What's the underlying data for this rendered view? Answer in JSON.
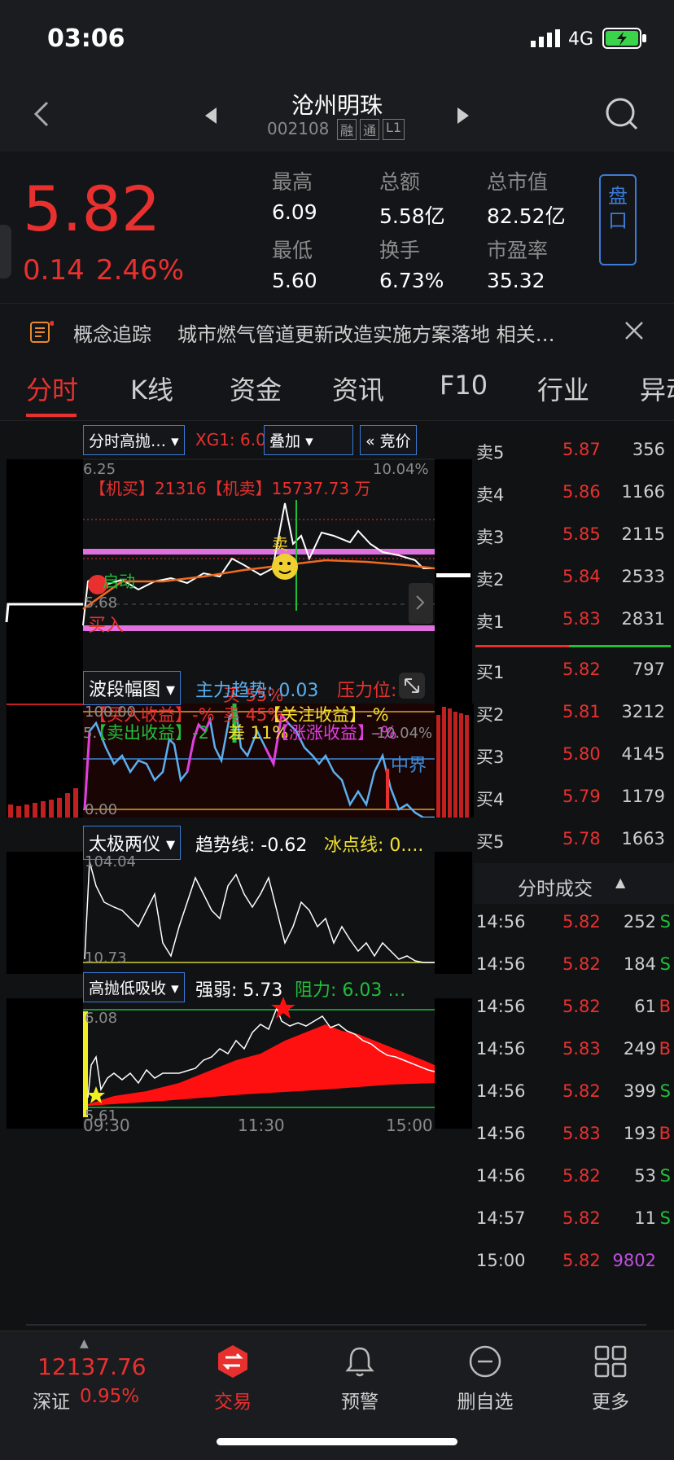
{
  "status": {
    "time": "03:06",
    "network": "4G"
  },
  "header": {
    "name": "沧州明珠",
    "code": "002108",
    "badges": [
      "融",
      "通",
      "L1"
    ]
  },
  "quote": {
    "price": "5.82",
    "change": "0.14",
    "change_pct": "2.46%",
    "stats": [
      {
        "label": "最高",
        "value": "6.09"
      },
      {
        "label": "总额",
        "value": "5.58亿"
      },
      {
        "label": "总市值",
        "value": "82.52亿"
      },
      {
        "label": "最低",
        "value": "5.60"
      },
      {
        "label": "换手",
        "value": "6.73%"
      },
      {
        "label": "市盈率",
        "value": "35.32"
      }
    ],
    "pan_button": "盘口"
  },
  "notice": {
    "tag": "概念追踪",
    "text": "城市燃气管道更新改造实施方案落地 相关…"
  },
  "tabs": [
    "分时",
    "K线",
    "资金",
    "资讯",
    "F10",
    "行业",
    "异动"
  ],
  "chart_top": {
    "selector": "分时高抛…",
    "xg": "XG1: 6.0",
    "overlay": "叠加",
    "auction": "« 竞价",
    "y_top": "6.25",
    "y_top_pct": "10.04%",
    "y_mid": "5.68",
    "y_bot": "5.",
    "y_bot_pct": "-10.04%",
    "machine": "【机买】21316【机卖】15737.73 万",
    "mark_qidong": "启动",
    "mark_buy": "买入",
    "mark_sell": "卖",
    "buy_pct": "买 55%",
    "sell_pct": "卖 45%",
    "diff": "差 11%",
    "row1_a": "【买入收益】-%",
    "row1_b": "【关注收益】-%",
    "row2_a": "【卖出收益】-2",
    "row2_b": "【涨涨收益】-%"
  },
  "panel2": {
    "selector": "波段幅图",
    "trend": "主力趋势: 0.03",
    "pressure": "压力位:",
    "y_top": "100.00",
    "y_bot": "0.00",
    "label_mid": "中界"
  },
  "panel3": {
    "selector": "太极两仪",
    "trend": "趋势线: -0.62",
    "ice": "冰点线: 0....",
    "y_top": "104.04",
    "y_bot": "10.73"
  },
  "panel4": {
    "selector": "高抛低吸收",
    "strength": "强弱: 5.73",
    "resist": "阻力: 6.03 …",
    "y_top": "6.08",
    "y_bot": "5.61"
  },
  "x_axis": [
    "09:30",
    "11:30",
    "15:00"
  ],
  "order_book": {
    "sell": [
      {
        "label": "卖5",
        "price": "5.87",
        "vol": "356"
      },
      {
        "label": "卖4",
        "price": "5.86",
        "vol": "1166"
      },
      {
        "label": "卖3",
        "price": "5.85",
        "vol": "2115"
      },
      {
        "label": "卖2",
        "price": "5.84",
        "vol": "2533"
      },
      {
        "label": "卖1",
        "price": "5.83",
        "vol": "2831"
      }
    ],
    "buy": [
      {
        "label": "买1",
        "price": "5.82",
        "vol": "797"
      },
      {
        "label": "买2",
        "price": "5.81",
        "vol": "3212"
      },
      {
        "label": "买3",
        "price": "5.80",
        "vol": "4145"
      },
      {
        "label": "买4",
        "price": "5.79",
        "vol": "1179"
      },
      {
        "label": "买5",
        "price": "5.78",
        "vol": "1663"
      }
    ]
  },
  "trades_header": "分时成交",
  "trades": [
    {
      "time": "14:56",
      "price": "5.82",
      "vol": "252",
      "side": "S"
    },
    {
      "time": "14:56",
      "price": "5.82",
      "vol": "184",
      "side": "S"
    },
    {
      "time": "14:56",
      "price": "5.82",
      "vol": "61",
      "side": "B"
    },
    {
      "time": "14:56",
      "price": "5.83",
      "vol": "249",
      "side": "B"
    },
    {
      "time": "14:56",
      "price": "5.82",
      "vol": "399",
      "side": "S"
    },
    {
      "time": "14:56",
      "price": "5.83",
      "vol": "193",
      "side": "B"
    },
    {
      "time": "14:56",
      "price": "5.82",
      "vol": "53",
      "side": "S"
    },
    {
      "time": "14:57",
      "price": "5.82",
      "vol": "11",
      "side": "S"
    },
    {
      "time": "15:00",
      "price": "5.82",
      "vol": "9802",
      "side": ""
    }
  ],
  "bottom": {
    "index_value": "12137.76",
    "index_name": "深证",
    "index_pct": "0.95%",
    "items": [
      "交易",
      "预警",
      "删自选",
      "更多"
    ]
  },
  "colors": {
    "up": "#e8312f",
    "down": "#1fbf3a",
    "accent": "#3c7bd6",
    "pink": "#e070e0"
  }
}
